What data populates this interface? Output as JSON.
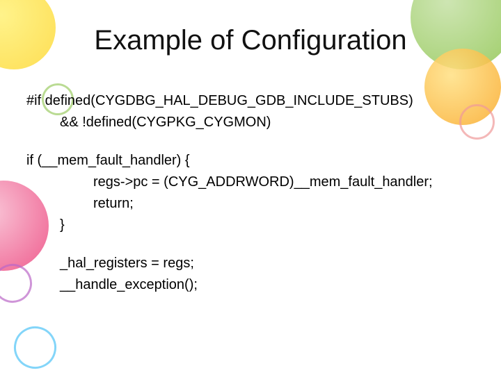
{
  "title": "Example of Configuration",
  "code": {
    "l1": "#if  defined(CYGDBG_HAL_DEBUG_GDB_INCLUDE_STUBS)",
    "l2": "&& !defined(CYGPKG_CYGMON)",
    "l3": "if (__mem_fault_handler) {",
    "l4": "regs->pc = (CYG_ADDRWORD)__mem_fault_handler;",
    "l5": "return;",
    "l6": "}",
    "l7": "_hal_registers = regs;",
    "l8": "__handle_exception();"
  }
}
